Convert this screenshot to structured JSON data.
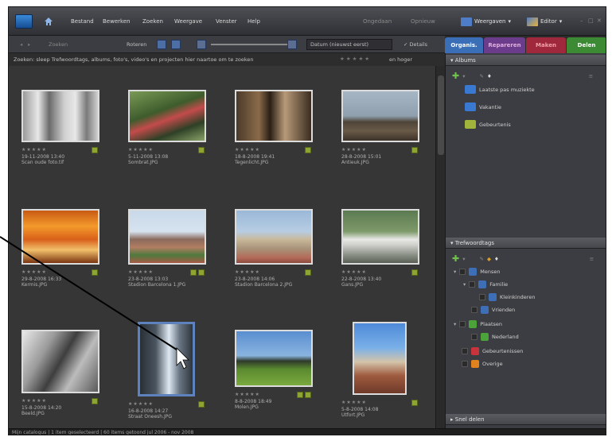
{
  "menubar": {
    "items": [
      "Bestand",
      "Bewerken",
      "Zoeken",
      "Weergave",
      "Venster",
      "Help"
    ],
    "undo": "Ongedaan",
    "redo": "Opnieuw",
    "view_button": "Weergaven",
    "editor_button": "Editor"
  },
  "toolbar": {
    "search_placeholder": "Zoeken",
    "rotate_label": "Roteren",
    "sort_label": "Datum (nieuwst eerst)",
    "details_label": "Details"
  },
  "tabs": [
    {
      "label": "Organis.",
      "color": "#3a6fb8"
    },
    {
      "label": "Repareren",
      "color": "#6b3b8c"
    },
    {
      "label": "Maken",
      "color": "#a0283c"
    },
    {
      "label": "Delen",
      "color": "#3d8a34"
    }
  ],
  "infoline": {
    "text": "Zoeken: sleep Trefwoordtags, albums, foto's, video's en projecten hier naartoe om te zoeken",
    "rating": "en hoger"
  },
  "thumbnails": [
    {
      "stars": "★★★★★",
      "date": "19-11-2008 13:40",
      "name": "Scan oude foto.tif"
    },
    {
      "stars": "★★★★★",
      "date": "5-11-2008 13:08",
      "name": "Sombrat.JPG"
    },
    {
      "stars": "★★★★★",
      "date": "18-8-2008 19:41",
      "name": "Tegenlicht.JPG"
    },
    {
      "stars": "★★★★★",
      "date": "28-8-2008 15:01",
      "name": "Antieuk.JPG"
    },
    {
      "stars": "★★★★★",
      "date": "29-8-2008 16:33",
      "name": "Kermis.JPG"
    },
    {
      "stars": "★★★★★",
      "date": "23-8-2008 13:03",
      "name": "Stadion Barcelona 1.JPG"
    },
    {
      "stars": "★★★★★",
      "date": "23-8-2008 14:06",
      "name": "Stadion Barcelona 2.JPG"
    },
    {
      "stars": "★★★★★",
      "date": "22-8-2008 13:40",
      "name": "Gans.JPG"
    },
    {
      "stars": "★★★★★",
      "date": "15-8-2008 14:20",
      "name": "Beeld.JPG"
    },
    {
      "stars": "★★★★★",
      "date": "16-8-2008 14:27",
      "name": "Straat Oneesh.JPG"
    },
    {
      "stars": "★★★★★",
      "date": "8-8-2008 18:49",
      "name": "Molen.JPG"
    },
    {
      "stars": "★★★★★",
      "date": "5-8-2008 14:08",
      "name": "Utfort.JPG"
    }
  ],
  "albums": {
    "header": "Albums",
    "items": [
      {
        "label": "Laatste pas muziekte",
        "icon_color": "#3a79d2"
      },
      {
        "label": "Vakantie",
        "icon_color": "#3a79d2"
      },
      {
        "label": "Gebeurtenis",
        "icon_color": "#a2b33c"
      }
    ]
  },
  "keywords": {
    "header": "Trefwoordtags",
    "items": [
      {
        "label": "Mensen",
        "icon_color": "#3e6eb6",
        "indent": 0
      },
      {
        "label": "Familie",
        "icon_color": "#3e6eb6",
        "indent": 1
      },
      {
        "label": "Kleinkinderen",
        "icon_color": "#3e6eb6",
        "indent": 2
      },
      {
        "label": "Vrienden",
        "icon_color": "#3e6eb6",
        "indent": 1
      },
      {
        "label": "Plaatsen",
        "icon_color": "#4ba33a",
        "indent": 0
      },
      {
        "label": "Nederland",
        "icon_color": "#4ba33a",
        "indent": 1
      },
      {
        "label": "Gebeurtenissen",
        "icon_color": "#c9333c",
        "indent": 0
      },
      {
        "label": "Overige",
        "icon_color": "#e0821e",
        "indent": 0
      }
    ]
  },
  "share_header": "Snel delen",
  "status": "Mijn catalogus  |  1 item geselecteerd  |  60 items getoond jul 2006 - nov 2008"
}
